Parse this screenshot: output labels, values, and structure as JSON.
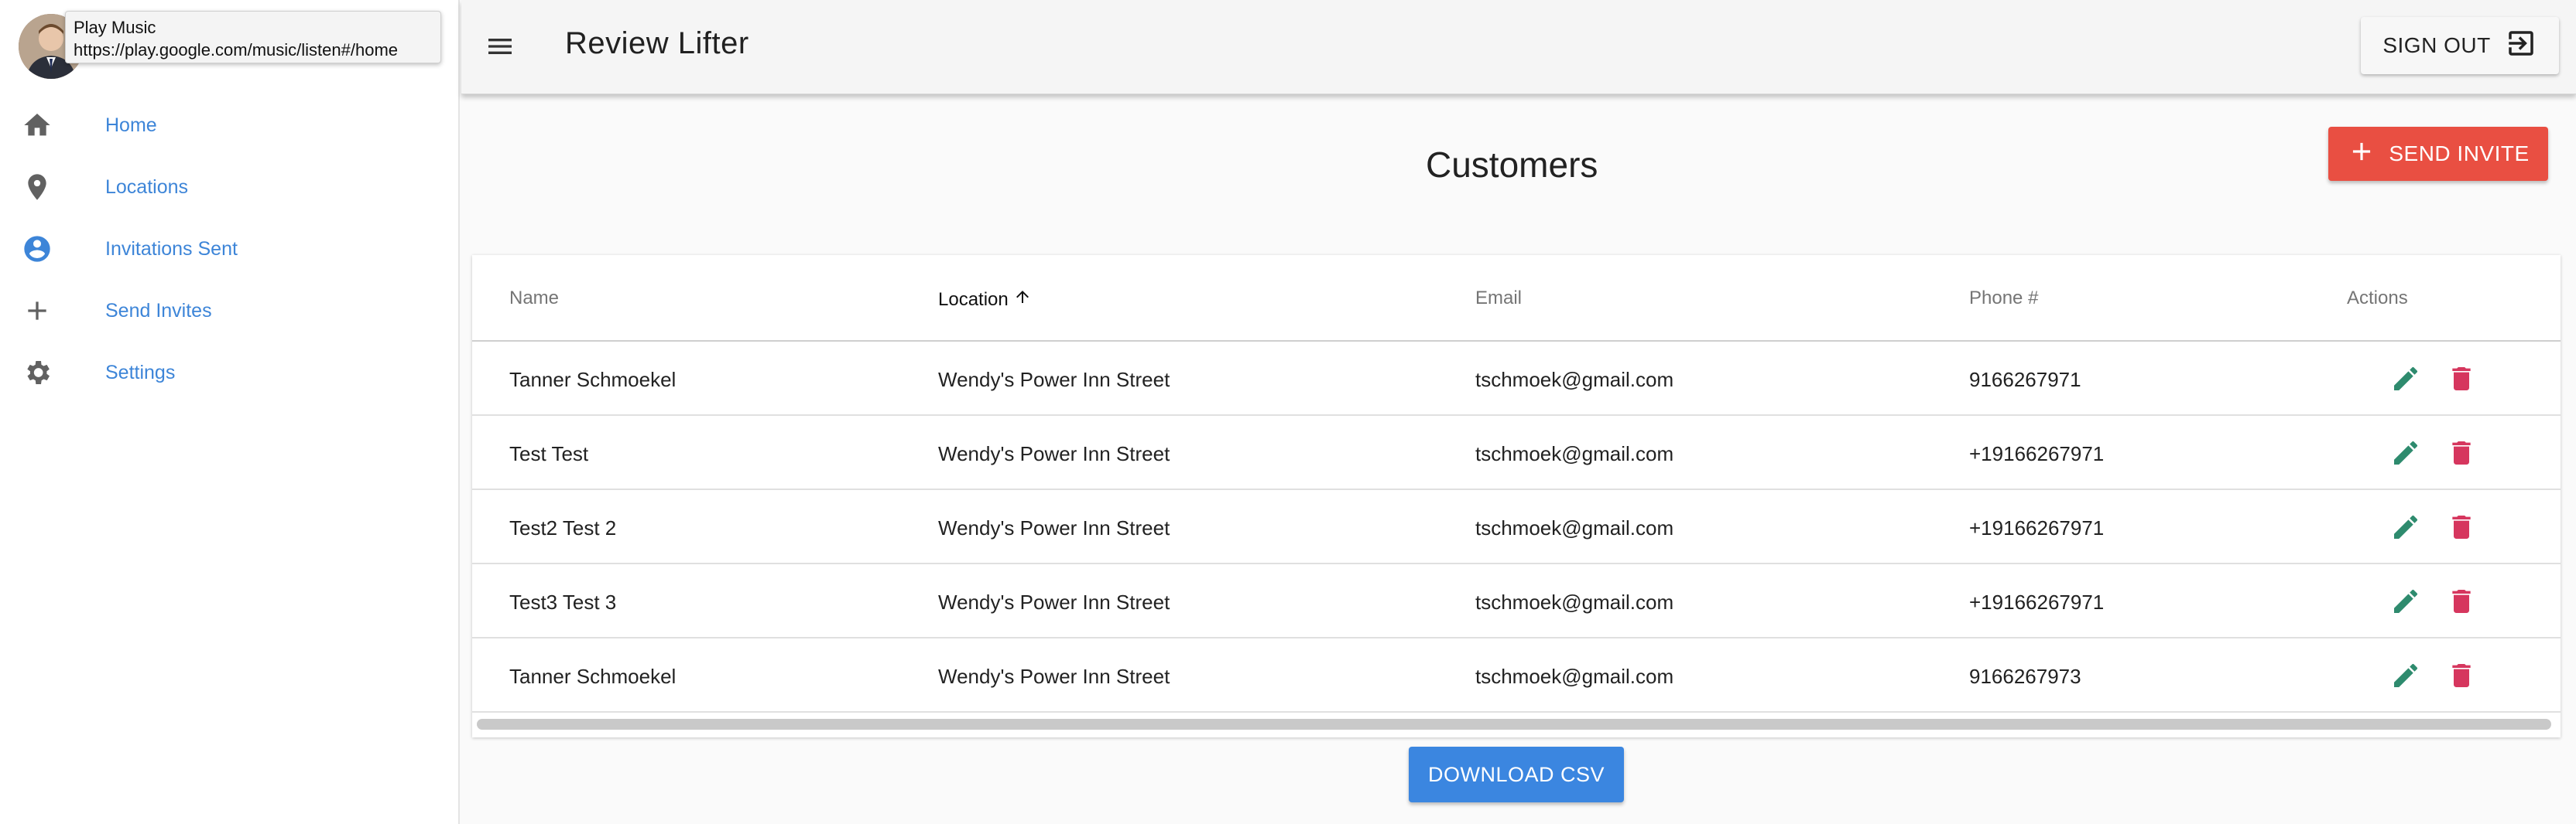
{
  "tooltip": {
    "title": "Play Music",
    "url": "https://play.google.com/music/listen#/home"
  },
  "sidebar": {
    "items": [
      {
        "label": "Home",
        "icon": "home-icon"
      },
      {
        "label": "Locations",
        "icon": "location-pin-icon"
      },
      {
        "label": "Invitations Sent",
        "icon": "account-circle-icon"
      },
      {
        "label": "Send Invites",
        "icon": "plus-icon"
      },
      {
        "label": "Settings",
        "icon": "gear-icon"
      }
    ]
  },
  "header": {
    "title": "Review Lifter",
    "signout_label": "SIGN OUT"
  },
  "main": {
    "title": "Customers",
    "send_invite_label": "SEND INVITE",
    "download_label": "DOWNLOAD CSV"
  },
  "table": {
    "columns": [
      "Name",
      "Location",
      "Email",
      "Phone #",
      "Actions"
    ],
    "sorted_column": "Location",
    "rows": [
      {
        "name": "Tanner Schmoekel",
        "location": "Wendy's Power Inn Street",
        "email": "tschmoek@gmail.com",
        "phone": "9166267971"
      },
      {
        "name": "Test Test",
        "location": "Wendy's Power Inn Street",
        "email": "tschmoek@gmail.com",
        "phone": "+19166267971"
      },
      {
        "name": "Test2 Test 2",
        "location": "Wendy's Power Inn Street",
        "email": "tschmoek@gmail.com",
        "phone": "+19166267971"
      },
      {
        "name": "Test3 Test 3",
        "location": "Wendy's Power Inn Street",
        "email": "tschmoek@gmail.com",
        "phone": "+19166267971"
      },
      {
        "name": "Tanner Schmoekel",
        "location": "Wendy's Power Inn Street",
        "email": "tschmoek@gmail.com",
        "phone": "9166267973"
      }
    ]
  },
  "colors": {
    "link": "#3d85d8",
    "send_invite": "#e94f42",
    "download": "#3b86e0",
    "edit": "#2e8b6e",
    "delete": "#d6365e"
  }
}
